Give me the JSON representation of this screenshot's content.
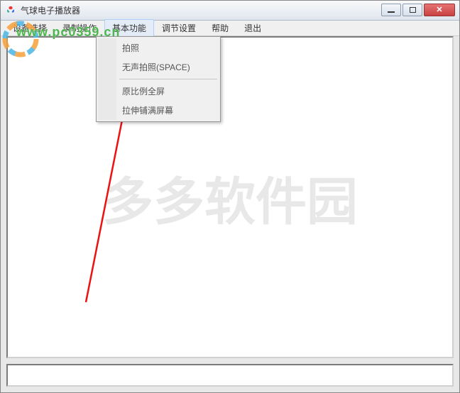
{
  "window": {
    "title": "气球电子播放器"
  },
  "menubar": {
    "items": [
      "设备选择",
      "录制操作",
      "基本功能",
      "调节设置",
      "帮助",
      "退出"
    ],
    "active_index": 2
  },
  "dropdown": {
    "items": [
      "拍照",
      "无声拍照(SPACE)",
      "原比例全屏",
      "拉伸铺满屏幕"
    ]
  },
  "watermark": {
    "url_text": "www.pc0359.cn",
    "big_text": "多多软件园"
  }
}
